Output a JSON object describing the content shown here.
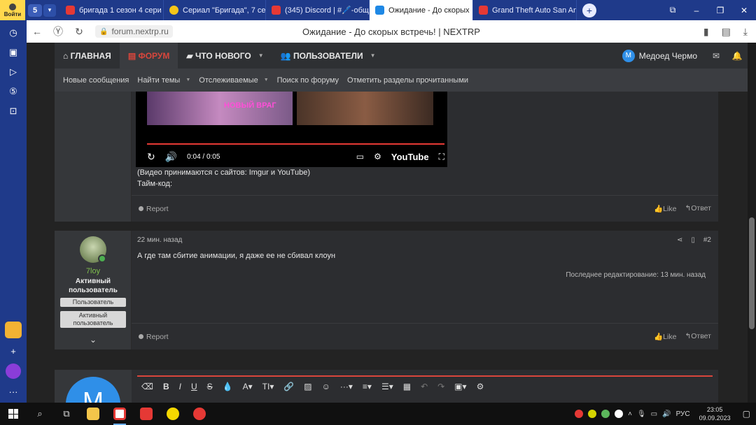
{
  "browser": {
    "login_label": "Войти",
    "tab_group_label": "5",
    "tabs": [
      {
        "label": "бригада 1 сезон 4 сери",
        "color": "#e53935"
      },
      {
        "label": "Сериал \"Бригада\", 7 сер",
        "color": "#f5c518"
      },
      {
        "label": "(345) Discord | #🖊️-общ",
        "color": "#e53935"
      },
      {
        "label": "Ожидание - До скорых",
        "color": "#1e88e5"
      },
      {
        "label": "Grand Theft Auto San An",
        "color": "#e53935"
      }
    ],
    "url": "forum.nextrp.ru",
    "page_title": "Ожидание - До скорых встречь! | NEXTRP"
  },
  "forum": {
    "nav": {
      "home": "ГЛАВНАЯ",
      "forum": "ФОРУМ",
      "whats_new": "ЧТО НОВОГО",
      "members": "ПОЛЬЗОВАТЕЛИ",
      "user_name": "Медоед Чермо",
      "user_initial": "М"
    },
    "subnav": [
      "Новые сообщения",
      "Найти темы",
      "Отслеживаемые",
      "Поиск по форуму",
      "Отметить разделы прочитанными"
    ],
    "post1": {
      "video_overlay": "НОВЫЙ ВРАГ",
      "video_time": "0:04 / 0:05",
      "video_brand": "YouTube",
      "line1": "(Видео принимаются с сайтов: Imgur и YouTube)",
      "line2": "Тайм-код:",
      "report": "Report",
      "like": "Like",
      "reply": "Ответ"
    },
    "post2": {
      "username": "7loy",
      "title": "Активный пользователь",
      "banner1": "Пользователь",
      "banner2": "Активный пользователь",
      "time": "22 мин. назад",
      "number": "#2",
      "body": "А где там сбитие анимации, я даже ее не сбивал клоун",
      "edited": "Последнее редактирование: 13 мин. назад",
      "report": "Report",
      "like": "Like",
      "reply": "Ответ"
    },
    "reply_avatar_initial": "М"
  },
  "taskbar": {
    "tray_lang": "РУС",
    "time": "23:05",
    "date": "09.09.2023"
  }
}
